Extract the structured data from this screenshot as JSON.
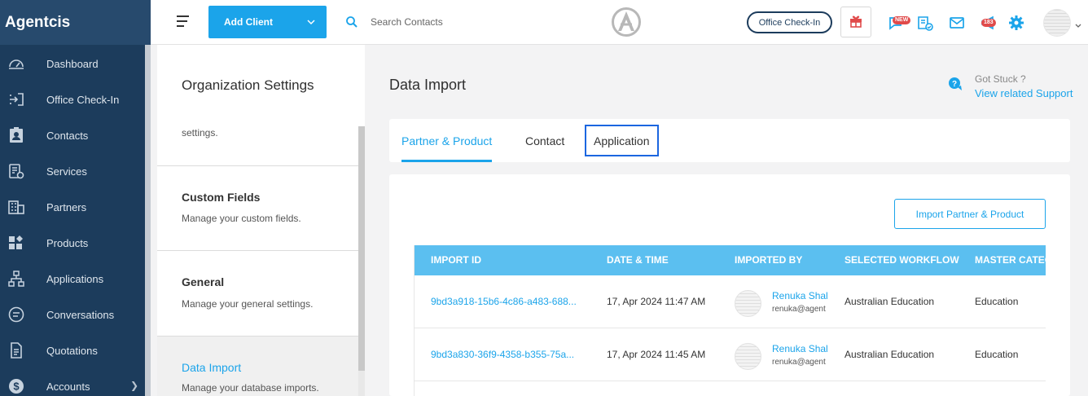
{
  "app": {
    "brand": "Agentcis"
  },
  "sidebar": {
    "items": [
      {
        "label": "Dashboard",
        "icon": "gauge-icon"
      },
      {
        "label": "Office Check-In",
        "icon": "checkin-icon"
      },
      {
        "label": "Contacts",
        "icon": "contacts-icon"
      },
      {
        "label": "Services",
        "icon": "services-icon"
      },
      {
        "label": "Partners",
        "icon": "building-icon"
      },
      {
        "label": "Products",
        "icon": "products-icon"
      },
      {
        "label": "Applications",
        "icon": "workflow-icon"
      },
      {
        "label": "Conversations",
        "icon": "chat-icon"
      },
      {
        "label": "Quotations",
        "icon": "document-icon"
      },
      {
        "label": "Accounts",
        "icon": "dollar-icon"
      }
    ]
  },
  "header": {
    "add_client": "Add Client",
    "search_placeholder": "Search Contacts",
    "office_checkin": "Office Check-In",
    "new_badge": "NEW",
    "notification_count": "183"
  },
  "settings": {
    "title": "Organization Settings",
    "partial_desc": "settings.",
    "items": [
      {
        "title": "Custom Fields",
        "desc": "Manage your custom fields."
      },
      {
        "title": "General",
        "desc": "Manage your general settings."
      },
      {
        "title": "Data Import",
        "desc": "Manage your database imports."
      }
    ]
  },
  "main": {
    "title": "Data Import",
    "support_question": "Got Stuck ?",
    "support_link": "View related Support",
    "tabs": [
      {
        "label": "Partner & Product"
      },
      {
        "label": "Contact"
      },
      {
        "label": "Application"
      }
    ],
    "import_button": "Import Partner & Product"
  },
  "table": {
    "columns": [
      "IMPORT ID",
      "DATE & TIME",
      "IMPORTED BY",
      "SELECTED WORKFLOW",
      "MASTER CATEG"
    ],
    "rows": [
      {
        "import_id": "9bd3a918-15b6-4c86-a483-688...",
        "datetime": "17, Apr 2024 11:47 AM",
        "user_name": "Renuka Shal",
        "user_email": "renuka@agent",
        "workflow": "Australian Education",
        "category": "Education"
      },
      {
        "import_id": "9bd3a830-36f9-4358-b355-75a...",
        "datetime": "17, Apr 2024 11:45 AM",
        "user_name": "Renuka Shal",
        "user_email": "renuka@agent",
        "workflow": "Australian Education",
        "category": "Education"
      }
    ]
  },
  "colors": {
    "sidebar_bg": "#1c3c5c",
    "accent": "#1ba4ea",
    "table_header": "#5bbff0",
    "focus_outline": "#1b66e0"
  }
}
